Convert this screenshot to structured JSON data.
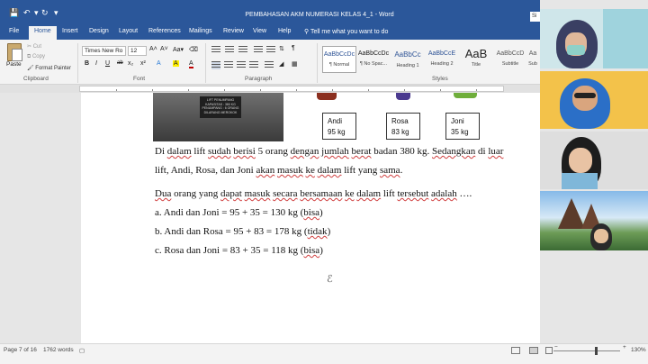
{
  "window": {
    "title": "PEMBAHASAN AKM NUMERASI KELAS 4_1 - Word",
    "signin_label": "Si"
  },
  "quick_access": {
    "icons": [
      "save-icon",
      "undo-icon",
      "redo-icon",
      "dropdown-icon"
    ]
  },
  "tabs": [
    {
      "label": "File"
    },
    {
      "label": "Home"
    },
    {
      "label": "Insert"
    },
    {
      "label": "Design"
    },
    {
      "label": "Layout"
    },
    {
      "label": "References"
    },
    {
      "label": "Mailings"
    },
    {
      "label": "Review"
    },
    {
      "label": "View"
    },
    {
      "label": "Help"
    }
  ],
  "tell_me": "Tell me what you want to do",
  "ribbon": {
    "clipboard": {
      "paste": "Paste",
      "cut": "Cut",
      "copy": "Copy",
      "format_painter": "Format Painter",
      "group_label": "Clipboard"
    },
    "font": {
      "font_name": "Times New Ro",
      "font_size": "12",
      "group_label": "Font",
      "format_buttons": [
        "B",
        "I",
        "U",
        "ab",
        "x₂",
        "x²",
        "A",
        "A",
        "A"
      ]
    },
    "paragraph": {
      "group_label": "Paragraph"
    },
    "styles": {
      "group_label": "Styles",
      "items": [
        {
          "preview": "AaBbCcDc",
          "name": "¶ Normal"
        },
        {
          "preview": "AaBbCcDc",
          "name": "¶ No Spac..."
        },
        {
          "preview": "AaBbCc",
          "name": "Heading 1"
        },
        {
          "preview": "AaBbCcE",
          "name": "Heading 2"
        },
        {
          "preview": "AaB",
          "name": "Title"
        },
        {
          "preview": "AaBbCcD",
          "name": "Subtitle"
        },
        {
          "preview": "Aa",
          "name": "Sub"
        }
      ]
    }
  },
  "document": {
    "lift_sign": "LIFT PENUMPANG\nKAPASITAS : 380 KG\nPENUMPANG : 6 ORANG\nDILARANG MEROKOK",
    "people": [
      {
        "name": "Andi",
        "weight": "95 kg"
      },
      {
        "name": "Rosa",
        "weight": "83 kg"
      },
      {
        "name": "Joni",
        "weight": "35 kg"
      }
    ],
    "paragraph1_line1": {
      "t1": "Di ",
      "u1": "dalam",
      "t2": " lift ",
      "u2": "sudah",
      "t3": " ",
      "u3": "berisi",
      "t4": " 5 orang ",
      "u4": "dengan",
      "t5": " ",
      "u5": "jumlah",
      "t6": " ",
      "u6": "berat",
      "t7": " badan 380 kg. ",
      "u7": "Sedangkan",
      "t8": " di ",
      "u8": "luar"
    },
    "paragraph1_line2": {
      "t1": "lift, Andi, Rosa, dan Joni ",
      "u1": "akan",
      "t2": " ",
      "u2": "masuk",
      "t3": " ",
      "u3": "ke",
      "t4": " ",
      "u4": "dalam",
      "t5": " lift yang ",
      "u5": "sama",
      "t6": "."
    },
    "question": {
      "u1": "Dua",
      "t1": " orang yang ",
      "u2": "dapat",
      "t2": " ",
      "u3": "masuk",
      "t3": " ",
      "u4": "secara",
      "t4": " ",
      "u5": "bersamaan",
      "t5": " ",
      "u6": "ke",
      "t6": " ",
      "u7": "dalam",
      "t7": " lift ",
      "u8": "tersebut",
      "t8": " ",
      "u9": "adalah",
      "t9": " …."
    },
    "options": [
      {
        "text": "a. Andi dan Joni = 95 + 35 = 130 kg (",
        "mark": "bisa",
        "end": ")"
      },
      {
        "text": "b. Andi dan Rosa = 95 + 83 = 178 kg (",
        "mark": "tidak",
        "end": ")"
      },
      {
        "text": "c. Rosa dan Joni = 83 + 35 = 118 kg (",
        "mark": "bisa",
        "end": ")"
      }
    ]
  },
  "status_bar": {
    "page": "Page 7 of 16",
    "words": "1762 words",
    "zoom": "130%"
  },
  "video_participants": 4
}
